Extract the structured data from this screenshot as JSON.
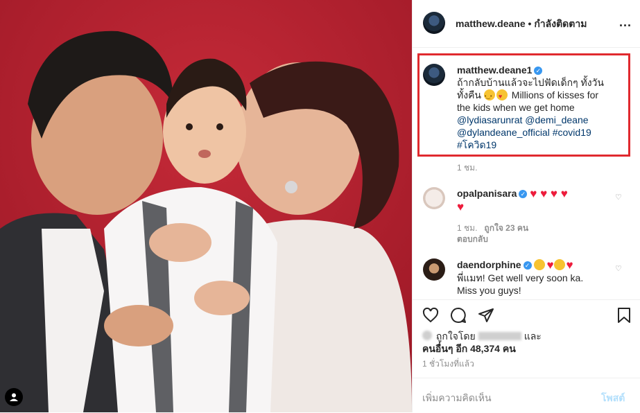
{
  "header": {
    "username": "matthew.deane",
    "separator": "•",
    "follow_status": "กำลังติดตาม",
    "more": "..."
  },
  "caption": {
    "username": "matthew.deane1",
    "text_line1": "ถ้ากลับบ้านแล้วจะไปฟัดเด็กๆ ทั้งวัน",
    "text_line2": "ทั้งคืน",
    "text_line2_rest": "Millions of kisses for",
    "text_line3": "the kids when we get home",
    "mention1": "@lydiasarunrat",
    "mention2": "@demi_deane",
    "mention3": "@dylandeane_official",
    "hashtag1": "#covid19",
    "hashtag2": "#โควิด19",
    "time": "1 ชม."
  },
  "comments": [
    {
      "username": "opalpanisara",
      "hearts_line1": "♥ ♥ ♥ ♥",
      "hearts_line2": "♥",
      "time": "1 ชม.",
      "likes": "ถูกใจ 23 คน",
      "reply": "ตอบกลับ"
    },
    {
      "username": "daendorphine",
      "text_line1": "พี่แมท! Get well very soon ka.",
      "text_line2": "Miss you guys!"
    }
  ],
  "likes": {
    "prefix": "ถูกใจโดย",
    "suffix": "และ",
    "others_label": "คนอื่นๆ อีก",
    "others_count": "48,374",
    "others_unit": "คน"
  },
  "post_time": "1 ชั่วโมงที่แล้ว",
  "add_comment": {
    "placeholder": "เพิ่มความคิดเห็น",
    "post_button": "โพสต์"
  },
  "icons": [
    "heart-icon",
    "comment-icon",
    "share-icon",
    "bookmark-icon",
    "user-tag-icon",
    "verified-icon"
  ],
  "colors": {
    "highlight_box": "#e0292e",
    "verified": "#3897f0",
    "link": "#00376b",
    "heart": "#ed1c3c",
    "photo_background": "#b5202f"
  }
}
